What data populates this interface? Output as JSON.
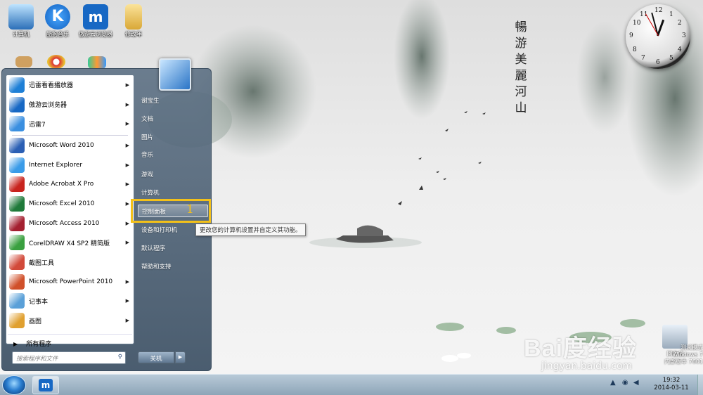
{
  "desktop": {
    "icons": [
      {
        "label": "计算机"
      },
      {
        "label": "酷狗音乐"
      },
      {
        "label": "傲游云浏览器"
      },
      {
        "label": "修改年"
      }
    ],
    "poem": "暢游美麗河山",
    "recycle_label": "回收站",
    "watermark_lines": [
      "测试模式",
      "Windows 7",
      "内部版本 7601"
    ],
    "baidu_logo": "Bai度经验",
    "baidu_url": "jingyan.baidu.com"
  },
  "start_menu": {
    "programs": [
      {
        "label": "迅雷看看播放器",
        "arrow": true,
        "icon_color": "#1e7fd6"
      },
      {
        "label": "傲游云浏览器",
        "arrow": true,
        "icon_color": "#1768c4"
      },
      {
        "label": "迅雷7",
        "arrow": true,
        "icon_color": "#3a8fe0"
      },
      {
        "label": "Microsoft Word 2010",
        "arrow": true,
        "icon_color": "#2b5fb4"
      },
      {
        "label": "Internet Explorer",
        "arrow": true,
        "icon_color": "#3a9be8"
      },
      {
        "label": "Adobe Acrobat X Pro",
        "arrow": true,
        "icon_color": "#c8241e"
      },
      {
        "label": "Microsoft Excel 2010",
        "arrow": true,
        "icon_color": "#1f7a3a"
      },
      {
        "label": "Microsoft Access 2010",
        "arrow": true,
        "icon_color": "#a42030"
      },
      {
        "label": "CorelDRAW X4 SP2 精简版",
        "arrow": true,
        "icon_color": "#3aa040"
      },
      {
        "label": "截图工具",
        "arrow": false,
        "icon_color": "#d24a3a"
      },
      {
        "label": "Microsoft PowerPoint 2010",
        "arrow": true,
        "icon_color": "#d0502a"
      },
      {
        "label": "记事本",
        "arrow": true,
        "icon_color": "#5aa0d8"
      },
      {
        "label": "画图",
        "arrow": true,
        "icon_color": "#e0a030"
      }
    ],
    "all_programs": "所有程序",
    "search_placeholder": "搜索程序和文件",
    "right_items": [
      {
        "label": "谢宝生"
      },
      {
        "label": "文档"
      },
      {
        "label": "图片"
      },
      {
        "label": "音乐"
      },
      {
        "label": "游戏"
      },
      {
        "label": "计算机"
      },
      {
        "label": "控制面板",
        "highlighted": true
      },
      {
        "label": "设备和打印机"
      },
      {
        "label": "默认程序"
      },
      {
        "label": "帮助和支持"
      }
    ],
    "shutdown_label": "关机",
    "annotation_number": "1",
    "tooltip": "更改您的计算机设置并自定义其功能。"
  },
  "taskbar": {
    "time": "19:32",
    "date": "2014-03-11"
  },
  "colors": {
    "highlight_border": "#f3c11a"
  }
}
